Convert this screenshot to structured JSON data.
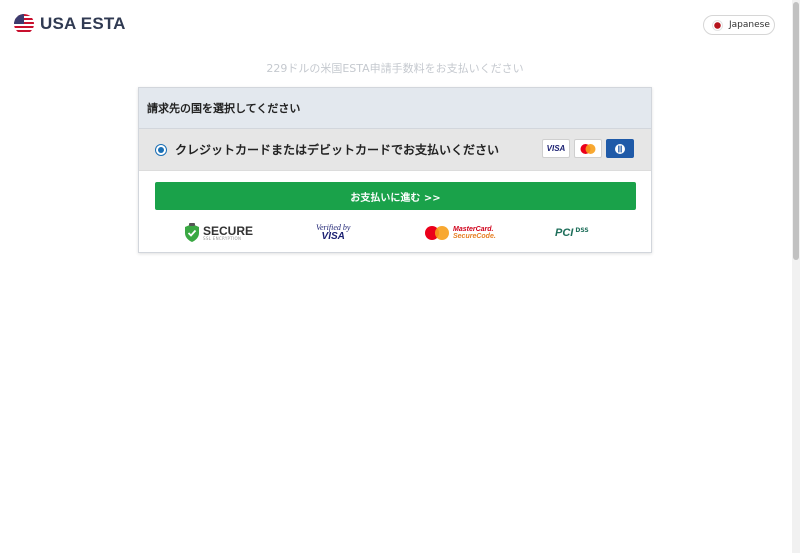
{
  "header": {
    "brand": "USA ESTA",
    "flag_icon": "us-flag-icon",
    "language_button": "Japanese",
    "language_icon": "japan-flag-icon"
  },
  "subtitle": "229ドルの米国ESTA申請手数料をお支払いください",
  "billing": {
    "heading": "請求先の国を選択してください",
    "payment_option": {
      "label": "クレジットカードまたはデビットカードでお支払いください",
      "selected": true,
      "card_logos": [
        "visa-icon",
        "mastercard-icon",
        "diners-club-icon"
      ],
      "visa_text": "VISA"
    },
    "proceed_button": "お支払いに進む >>"
  },
  "trust_badges": {
    "secure": {
      "main": "SECURE",
      "sub": "SSL ENCRYPTION"
    },
    "verified_by_visa": {
      "line1": "Verified by",
      "line2": "VISA"
    },
    "mastercard_securecode": {
      "line1": "MasterCard.",
      "line2": "SecureCode."
    },
    "pci_dss": {
      "main": "PCI",
      "sub": "DSS"
    }
  },
  "colors": {
    "accent_green": "#1aa24a",
    "radio_blue": "#1a6fb5",
    "header_bg": "#e3e8ee",
    "brand_text": "#303a52"
  }
}
